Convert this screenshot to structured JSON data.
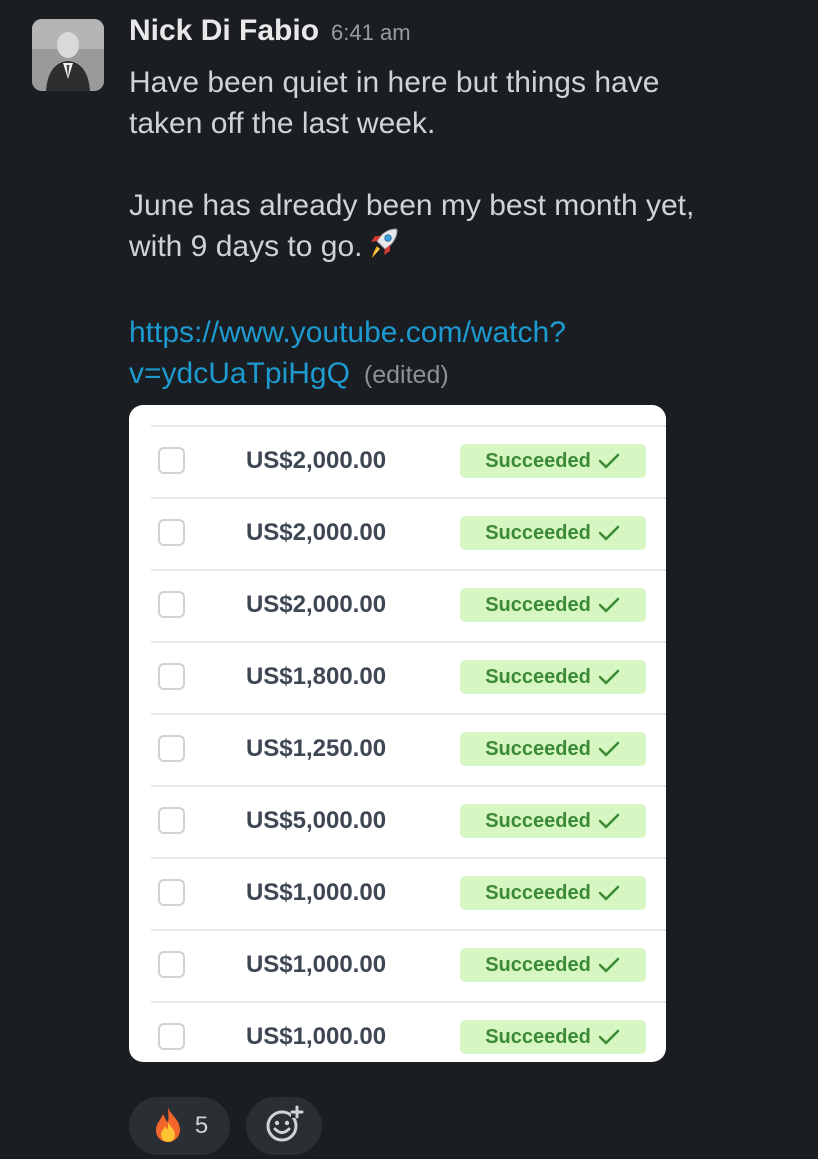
{
  "message": {
    "author": "Nick Di Fabio",
    "time": "6:41 am",
    "lines": [
      "Have been quiet in here but things have",
      "taken off the last week.",
      "June has already been my best month yet,",
      "with 9 days to go."
    ],
    "emoji": "rocket-icon",
    "link_lines": [
      "https://www.youtube.com/watch?",
      "v=ydcUaTpiHgQ"
    ],
    "edited_label": "(edited)"
  },
  "payments": {
    "rows": [
      {
        "amount": "US$2,000.00",
        "status": "Succeeded"
      },
      {
        "amount": "US$2,000.00",
        "status": "Succeeded"
      },
      {
        "amount": "US$2,000.00",
        "status": "Succeeded"
      },
      {
        "amount": "US$1,800.00",
        "status": "Succeeded"
      },
      {
        "amount": "US$1,250.00",
        "status": "Succeeded"
      },
      {
        "amount": "US$5,000.00",
        "status": "Succeeded"
      },
      {
        "amount": "US$1,000.00",
        "status": "Succeeded"
      },
      {
        "amount": "US$1,000.00",
        "status": "Succeeded"
      },
      {
        "amount": "US$1,000.00",
        "status": "Succeeded"
      }
    ]
  },
  "reactions": [
    {
      "icon": "fire-icon",
      "count": "5"
    }
  ],
  "add_reaction": {
    "icon": "add-reaction-icon"
  },
  "colors": {
    "background": "#1a1d21",
    "link": "#1d9bd1",
    "badge_bg": "#d7f7c2",
    "badge_text": "#3c8a35"
  }
}
